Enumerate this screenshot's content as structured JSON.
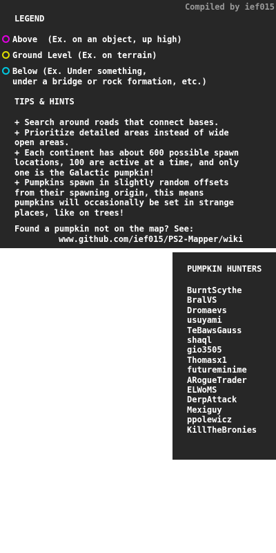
{
  "credit": "Compiled by ief015",
  "legend": {
    "title": "LEGEND",
    "items": [
      {
        "label": "Above  (Ex. on an object, up high)",
        "color": "#e000e0"
      },
      {
        "label": "Ground Level (Ex. on terrain)",
        "color": "#e0e000"
      },
      {
        "label": "Below (Ex. Under something,\nunder a bridge or rock formation, etc.)",
        "color": "#00c8e0"
      }
    ]
  },
  "tips": {
    "title": "TIPS & HINTS",
    "items": [
      "+ Search around roads that connect bases.",
      "+ Prioritize detailed areas instead of wide\nopen areas.",
      "+ Each continent has about 600 possible spawn\nlocations, 100 are active at a time, and only\none is the Galactic pumpkin!",
      "+ Pumpkins spawn in slightly random offsets\nfrom their spawning origin, this means\npumpkins will occasionally be set in strange\nplaces, like on trees!"
    ]
  },
  "found": {
    "text": "Found a pumpkin not on the map? See:",
    "url": "www.github.com/ief015/PS2-Mapper/wiki"
  },
  "hunters": {
    "title": "PUMPKIN HUNTERS",
    "names": [
      "BurntScythe",
      "BralVS",
      "Dromaevs",
      "usuyami",
      "TeBawsGauss",
      "shaql",
      "gio3505",
      "Thomasx1",
      "futureminime",
      "ARogueTrader",
      "ELWoMS",
      "DerpAttack",
      "Mexiguy",
      "ppolewicz",
      "KillTheBronies"
    ]
  }
}
